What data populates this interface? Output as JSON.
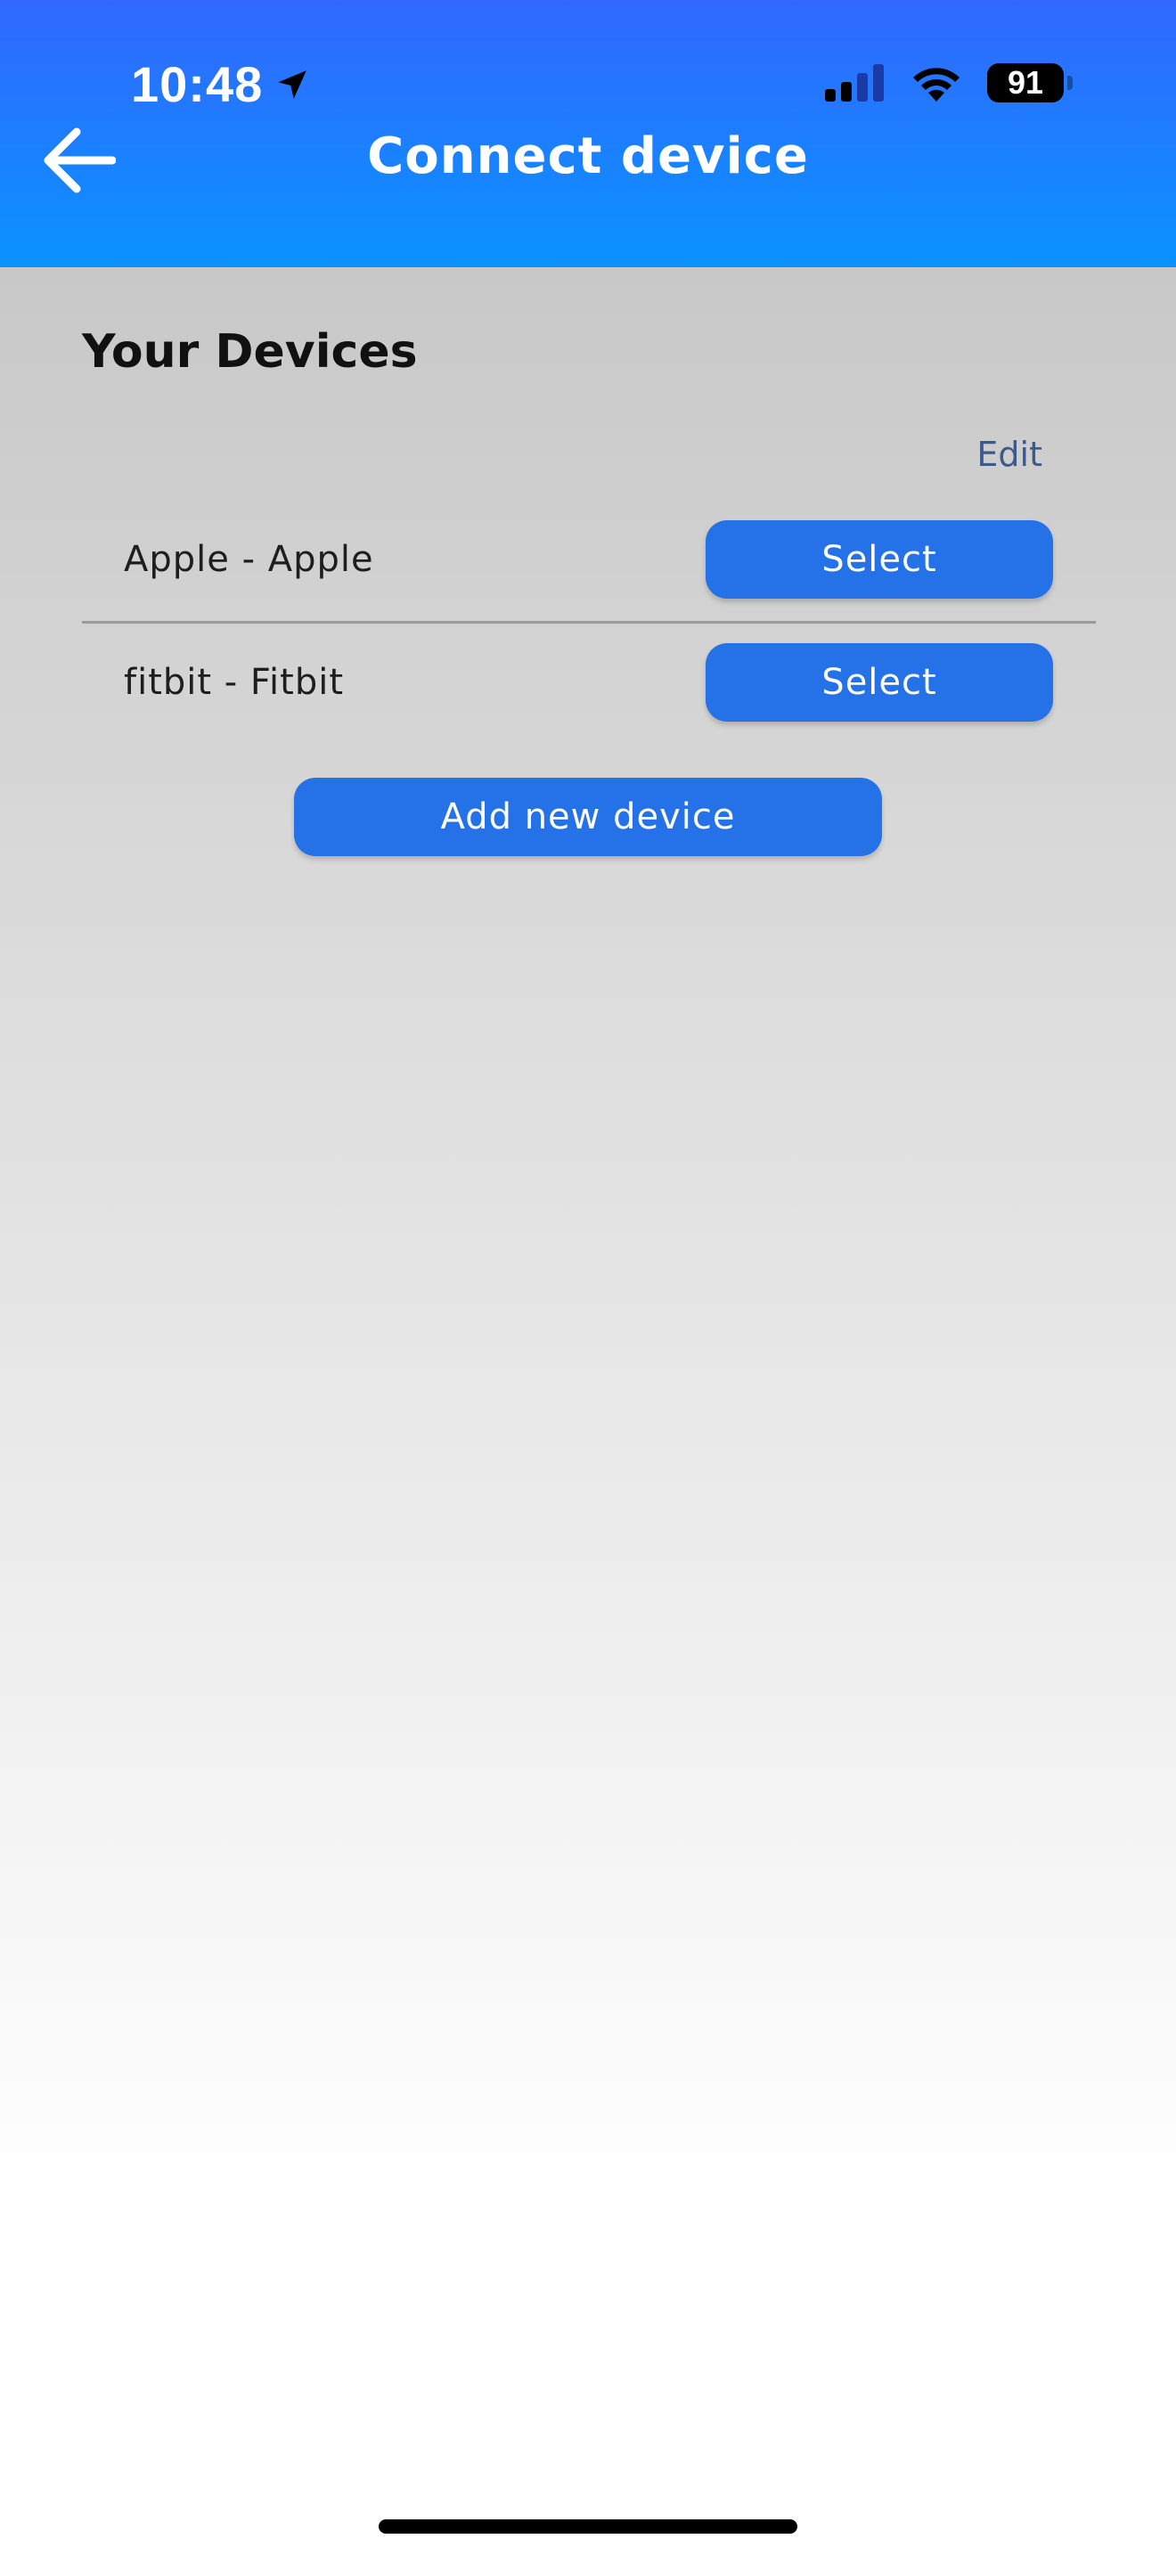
{
  "status_bar": {
    "time": "10:48",
    "battery": "91"
  },
  "header": {
    "title": "Connect device",
    "back_icon": "arrow-left-icon"
  },
  "devices": {
    "section_title": "Your Devices",
    "edit_label": "Edit",
    "items": [
      {
        "label": "Apple - Apple",
        "button_label": "Select"
      },
      {
        "label": "fitbit - Fitbit",
        "button_label": "Select"
      }
    ],
    "add_label": "Add new device"
  },
  "colors": {
    "header_top": "#3168ff",
    "header_bottom": "#0a93ff",
    "button": "#2471e8",
    "edit_link": "#3d5a8a"
  }
}
